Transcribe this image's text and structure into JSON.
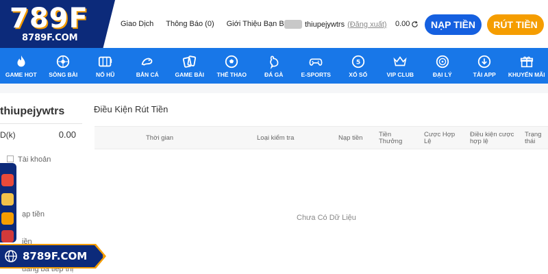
{
  "logo": {
    "main": "789F",
    "sub": "8789F.COM"
  },
  "header": {
    "links": [
      "Giao Dịch",
      "Thông Báo (0)",
      "Giới Thiệu Bạn Bè"
    ],
    "username": "thiupejywtrs",
    "logout": "(Đăng xuất)",
    "balance": "0.00",
    "deposit_label": "NẠP TIỀN",
    "withdraw_label": "RÚT TIỀN"
  },
  "nav": [
    {
      "label": "GAME HOT",
      "icon": "flame-icon"
    },
    {
      "label": "SÒNG BÀI",
      "icon": "roulette-icon"
    },
    {
      "label": "NỔ HŨ",
      "icon": "slot-icon"
    },
    {
      "label": "BẮN CÁ",
      "icon": "fish-icon"
    },
    {
      "label": "GAME BÀI",
      "icon": "cards-icon"
    },
    {
      "label": "THỂ THAO",
      "icon": "soccer-ball-icon"
    },
    {
      "label": "ĐÁ GÀ",
      "icon": "rooster-icon"
    },
    {
      "label": "E-SPORTS",
      "icon": "gamepad-icon"
    },
    {
      "label": "XỔ SỐ",
      "icon": "lottery-ball-icon"
    },
    {
      "label": "VIP CLUB",
      "icon": "crown-icon"
    },
    {
      "label": "ĐẠI LÝ",
      "icon": "agent-icon"
    },
    {
      "label": "TẢI APP",
      "icon": "download-icon"
    },
    {
      "label": "KHUYẾN MÃI",
      "icon": "gift-icon"
    }
  ],
  "sidebar": {
    "username": "thiupejywtrs",
    "balance_label": "D(k)",
    "balance_value": "0.00",
    "items": [
      "Tài khoản",
      "ạp tiền",
      "iền",
      "uảng bá tiếp thị"
    ]
  },
  "main": {
    "title": "Điều Kiện Rút Tiền",
    "columns": [
      "Thời gian",
      "Loại kiểm tra",
      "Nạp tiền",
      "Tiền Thưởng",
      "Cược Hợp Lệ",
      "Điều kiện cược hợp lệ",
      "Trạng thái"
    ],
    "empty_text": "Chưa Có Dữ Liệu"
  },
  "badge": {
    "text": "8789F.COM"
  },
  "colors": {
    "primary": "#1877e8",
    "navy": "#0c2a7a",
    "orange": "#f59d00",
    "deposit": "#1560e0"
  }
}
